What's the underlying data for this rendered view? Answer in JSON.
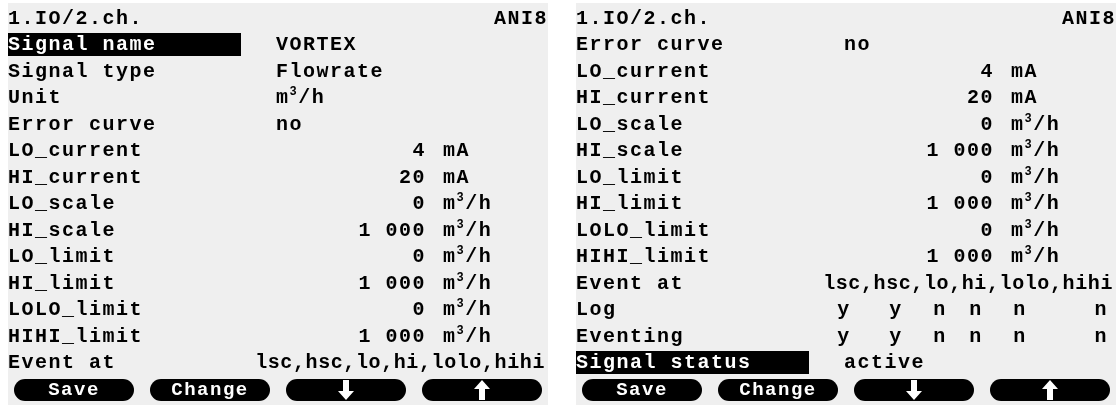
{
  "screens": [
    {
      "path": "1.IO/2.ch.",
      "module": "ANI8",
      "rows": [
        {
          "kind": "text",
          "label": "Signal name",
          "value": "VORTEX",
          "selected": true
        },
        {
          "kind": "text",
          "label": "Signal type",
          "value": "Flowrate",
          "selected": false
        },
        {
          "kind": "text",
          "label": "Unit",
          "value": "m$^{3}$/h",
          "selected": false
        },
        {
          "kind": "text",
          "label": "Error curve",
          "value": "no",
          "selected": false
        },
        {
          "kind": "number",
          "label": "LO_current",
          "value": "4",
          "unit": "mA",
          "selected": false
        },
        {
          "kind": "number",
          "label": "HI_current",
          "value": "20",
          "unit": "mA",
          "selected": false
        },
        {
          "kind": "number",
          "label": "LO_scale",
          "value": "0",
          "unit": "m$^{3}$/h",
          "selected": false
        },
        {
          "kind": "number",
          "label": "HI_scale",
          "value": "1 000",
          "unit": "m$^{3}$/h",
          "selected": false
        },
        {
          "kind": "number",
          "label": "LO_limit",
          "value": "0",
          "unit": "m$^{3}$/h",
          "selected": false
        },
        {
          "kind": "number",
          "label": "HI_limit",
          "value": "1 000",
          "unit": "m$^{3}$/h",
          "selected": false
        },
        {
          "kind": "number",
          "label": "LOLO_limit",
          "value": "0",
          "unit": "m$^{3}$/h",
          "selected": false
        },
        {
          "kind": "number",
          "label": "HIHI_limit",
          "value": "1 000",
          "unit": "m$^{3}$/h",
          "selected": false
        },
        {
          "kind": "list",
          "label": "Event at",
          "value": "lsc,hsc,lo,hi,lolo,hihi",
          "selected": false
        }
      ],
      "buttons": [
        {
          "kind": "text",
          "label": "Save"
        },
        {
          "kind": "text",
          "label": "Change"
        },
        {
          "kind": "arrow-down"
        },
        {
          "kind": "arrow-up"
        }
      ]
    },
    {
      "path": "1.IO/2.ch.",
      "module": "ANI8",
      "rows": [
        {
          "kind": "text",
          "label": "Error curve",
          "value": "no",
          "selected": false
        },
        {
          "kind": "number",
          "label": "LO_current",
          "value": "4",
          "unit": "mA",
          "selected": false
        },
        {
          "kind": "number",
          "label": "HI_current",
          "value": "20",
          "unit": "mA",
          "selected": false
        },
        {
          "kind": "number",
          "label": "LO_scale",
          "value": "0",
          "unit": "m$^{3}$/h",
          "selected": false
        },
        {
          "kind": "number",
          "label": "HI_scale",
          "value": "1 000",
          "unit": "m$^{3}$/h",
          "selected": false
        },
        {
          "kind": "number",
          "label": "LO_limit",
          "value": "0",
          "unit": "m$^{3}$/h",
          "selected": false
        },
        {
          "kind": "number",
          "label": "HI_limit",
          "value": "1 000",
          "unit": "m$^{3}$/h",
          "selected": false
        },
        {
          "kind": "number",
          "label": "LOLO_limit",
          "value": "0",
          "unit": "m$^{3}$/h",
          "selected": false
        },
        {
          "kind": "number",
          "label": "HIHI_limit",
          "value": "1 000",
          "unit": "m$^{3}$/h",
          "selected": false
        },
        {
          "kind": "list",
          "label": "Event at",
          "value": "lsc,hsc,lo,hi,lolo,hihi",
          "selected": false
        },
        {
          "kind": "flags",
          "label": "Log",
          "values": [
            "y",
            "y",
            "n",
            "n",
            "n",
            "n"
          ],
          "selected": false
        },
        {
          "kind": "flags",
          "label": "Eventing",
          "values": [
            "y",
            "y",
            "n",
            "n",
            "n",
            "n"
          ],
          "selected": false
        },
        {
          "kind": "text",
          "label": "Signal status",
          "value": "active",
          "selected": true
        }
      ],
      "buttons": [
        {
          "kind": "text",
          "label": "Save"
        },
        {
          "kind": "text",
          "label": "Change"
        },
        {
          "kind": "arrow-down"
        },
        {
          "kind": "arrow-up"
        }
      ]
    }
  ]
}
